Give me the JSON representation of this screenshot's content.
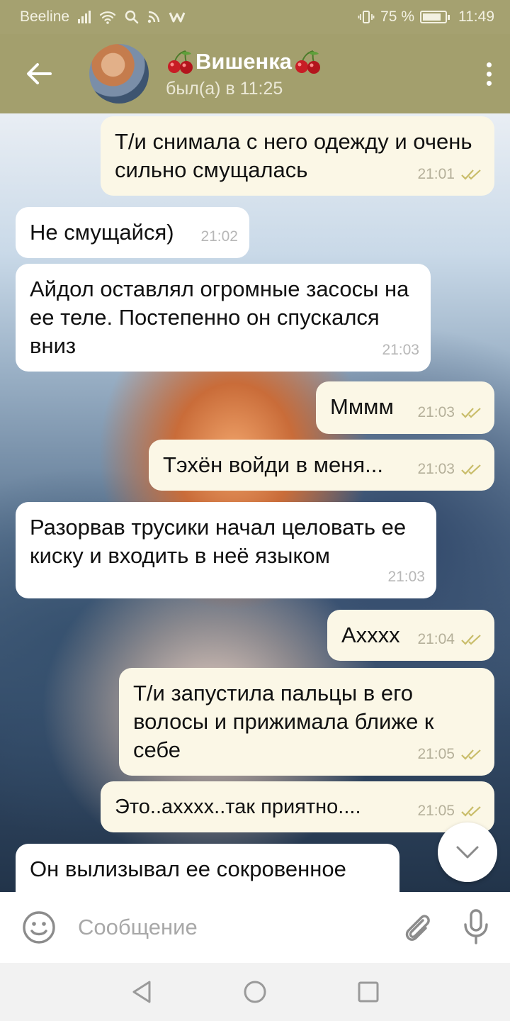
{
  "status_bar": {
    "carrier": "Beeline",
    "battery": "75 %",
    "battery_level": 0.75,
    "time": "11:49"
  },
  "header": {
    "contact_name": "Вишенка",
    "last_seen": "был(а) в 11:25",
    "icons": [
      "back-arrow-icon",
      "avatar",
      "cherry-icon",
      "more-vertical-icon"
    ]
  },
  "messages": [
    {
      "dir": "out",
      "text": "Т/и снимала с него одежду и очень сильно смущалась",
      "time": "21:01",
      "read": true
    },
    {
      "dir": "in",
      "text": "Не смущайся)",
      "time": "21:02"
    },
    {
      "dir": "in",
      "text": "Айдол оставлял огромные засосы на ее теле. Постепенно он спускался вниз",
      "time": "21:03"
    },
    {
      "dir": "out",
      "text": "Мммм",
      "time": "21:03",
      "read": true
    },
    {
      "dir": "out",
      "text": "Тэхён войди в меня...",
      "time": "21:03",
      "read": true
    },
    {
      "dir": "in",
      "text": "Разорвав трусики начал целовать ее киску и входить в неё языком",
      "time": "21:03"
    },
    {
      "dir": "out",
      "text": "Ахххх",
      "time": "21:04",
      "read": true
    },
    {
      "dir": "out",
      "text": "Т/и запустила пальцы в его волосы и прижимала ближе к себе",
      "time": "21:05",
      "read": true
    },
    {
      "dir": "out",
      "text": "Это..ахххх..так приятно....",
      "time": "21:05",
      "read": true
    },
    {
      "dir": "in",
      "text": "Он вылизывал ее сокровенное",
      "time": ""
    }
  ],
  "composer": {
    "placeholder": "Сообщение",
    "icons": [
      "emoji-icon",
      "paperclip-icon",
      "microphone-icon"
    ]
  },
  "colors": {
    "header_bg": "#a39f6d",
    "status_bg": "#a5a170",
    "outgoing_bubble": "#fbf7e6",
    "incoming_bubble": "#ffffff",
    "check_color": "#c9bd6a"
  }
}
